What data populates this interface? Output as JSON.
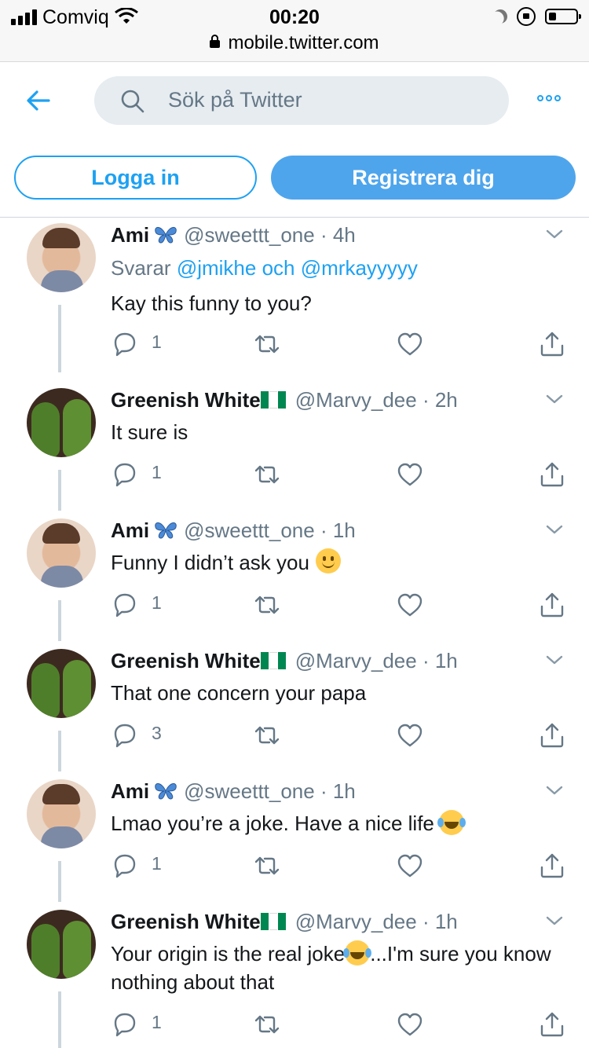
{
  "statusbar": {
    "carrier": "Comviq",
    "time": "00:20",
    "url": "mobile.twitter.com"
  },
  "nav": {
    "search_placeholder": "Sök på Twitter",
    "back_icon": "arrow-left-icon",
    "more_icon": "more-icon"
  },
  "auth": {
    "login_label": "Logga in",
    "signup_label": "Registrera dig"
  },
  "colors": {
    "accent": "#1da1f2",
    "signup_bg": "#4ea5ec",
    "secondary_text": "#657786"
  },
  "tweets": [
    {
      "name": "Ami",
      "name_emoji": "butterfly",
      "handle": "@sweettt_one",
      "time": "4h",
      "reply_prefix": "Svarar",
      "reply_user1": "@jmikhe",
      "reply_and": "och",
      "reply_user2": "@mrkayyyyy",
      "text": "Kay this funny to you?",
      "reply_count": "1"
    },
    {
      "name": "Greenish White",
      "name_emoji": "nigeria-flag",
      "handle": "@Marvy_dee",
      "time": "2h",
      "text": "It sure is",
      "reply_count": "1"
    },
    {
      "name": "Ami",
      "name_emoji": "butterfly",
      "handle": "@sweettt_one",
      "time": "1h",
      "text": "Funny I didn’t ask you",
      "text_emoji": "slightly-smiling-face",
      "reply_count": "1"
    },
    {
      "name": "Greenish White",
      "name_emoji": "nigeria-flag",
      "handle": "@Marvy_dee",
      "time": "1h",
      "text": "That one concern your papa",
      "reply_count": "3"
    },
    {
      "name": "Ami",
      "name_emoji": "butterfly",
      "handle": "@sweettt_one",
      "time": "1h",
      "text": "Lmao you’re a joke. Have a nice life",
      "text_emoji": "face-with-tears-of-joy",
      "reply_count": "1"
    },
    {
      "name": "Greenish White",
      "name_emoji": "nigeria-flag",
      "handle": "@Marvy_dee",
      "time": "1h",
      "text_part1": "Your origin is the real joke",
      "text_emoji": "face-with-tears-of-joy",
      "text_part2": "...I'm sure you know nothing about that",
      "reply_count": "1"
    }
  ]
}
